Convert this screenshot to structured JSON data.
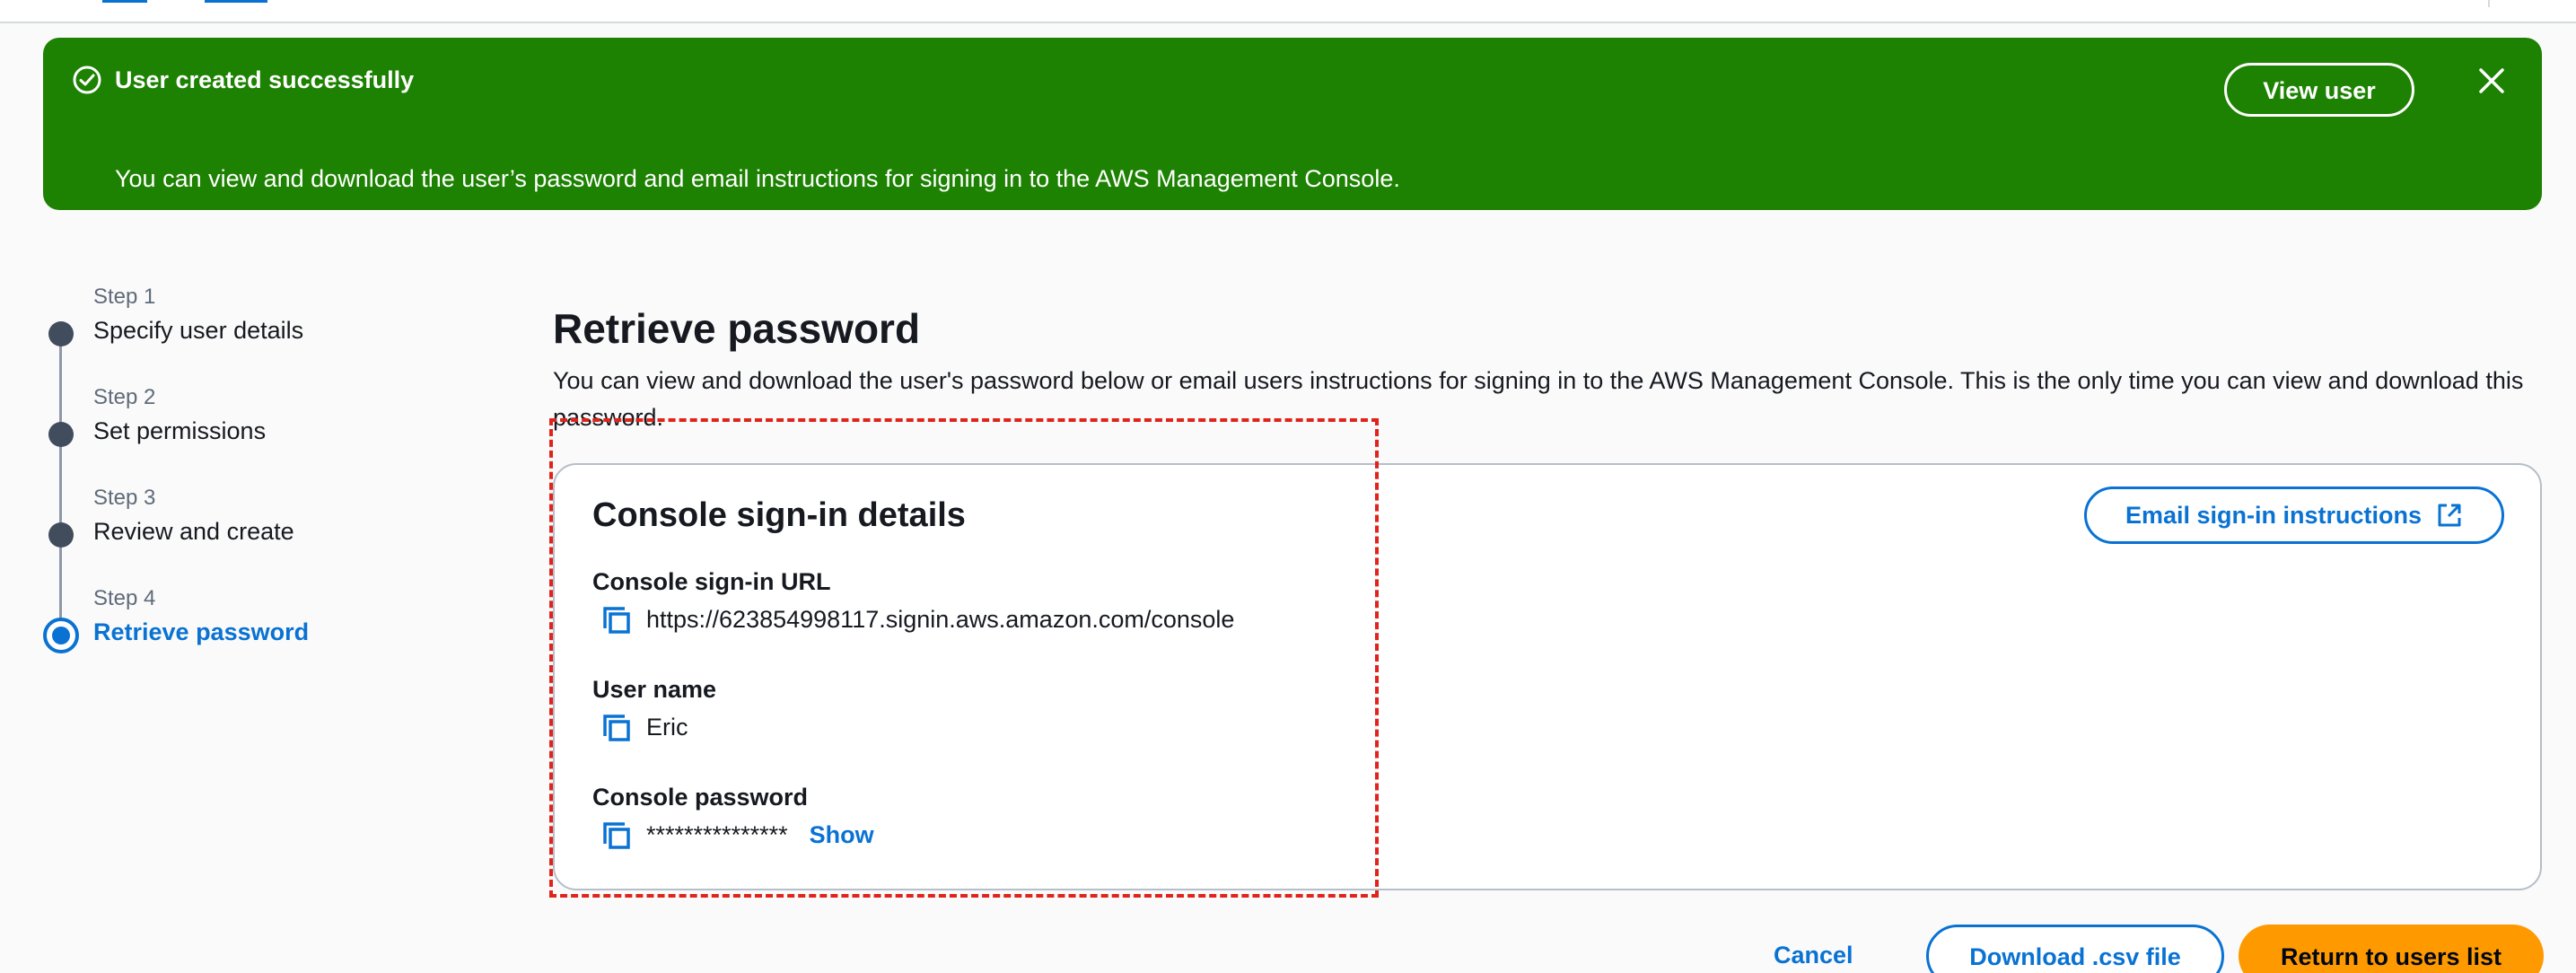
{
  "flash": {
    "title": "User created successfully",
    "message": "You can view and download the user’s password and email instructions for signing in to the AWS Management Console.",
    "view_user_label": "View user",
    "color": "#1d8102"
  },
  "steps": [
    {
      "num": "Step 1",
      "label": "Specify user details",
      "active": false
    },
    {
      "num": "Step 2",
      "label": "Set permissions",
      "active": false
    },
    {
      "num": "Step 3",
      "label": "Review and create",
      "active": false
    },
    {
      "num": "Step 4",
      "label": "Retrieve password",
      "active": true
    }
  ],
  "main": {
    "title": "Retrieve password",
    "description": "You can view and download the user's password below or email users instructions for signing in to the AWS Management Console. This is the only time you can view and download this password."
  },
  "card": {
    "title": "Console sign-in details",
    "email_button_label": "Email sign-in instructions",
    "fields": [
      {
        "label": "Console sign-in URL",
        "value": "https://623854998117.signin.aws.amazon.com/console"
      },
      {
        "label": "User name",
        "value": "Eric"
      },
      {
        "label": "Console password",
        "value": "***************",
        "show_label": "Show"
      }
    ]
  },
  "footer": {
    "cancel_label": "Cancel",
    "download_label": "Download .csv file",
    "return_label": "Return to users list"
  },
  "colors": {
    "accent": "#0972d3",
    "primary_button": "#ff9900",
    "annotation": "#e0241b"
  }
}
